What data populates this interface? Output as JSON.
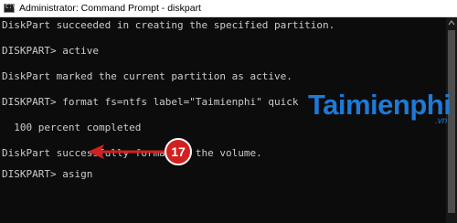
{
  "window": {
    "title": "Administrator: Command Prompt - diskpart",
    "icon_text": "C:\\"
  },
  "console": {
    "lines": [
      "DiskPart succeeded in creating the specified partition.",
      "DISKPART> active",
      "DiskPart marked the current partition as active.",
      "DISKPART> format fs=ntfs label=\"Taimienphi\" quick",
      "  100 percent completed",
      "DiskPart successfully formatted the volume.",
      "DISKPART> asign"
    ]
  },
  "watermark": {
    "text": "Taimienphi",
    "suffix": ".vn",
    "color": "#1e7ad6"
  },
  "annotation": {
    "step": "17",
    "color": "#d1201f"
  },
  "colors": {
    "console_bg": "#0c0c0c",
    "console_text": "#cccccc"
  }
}
